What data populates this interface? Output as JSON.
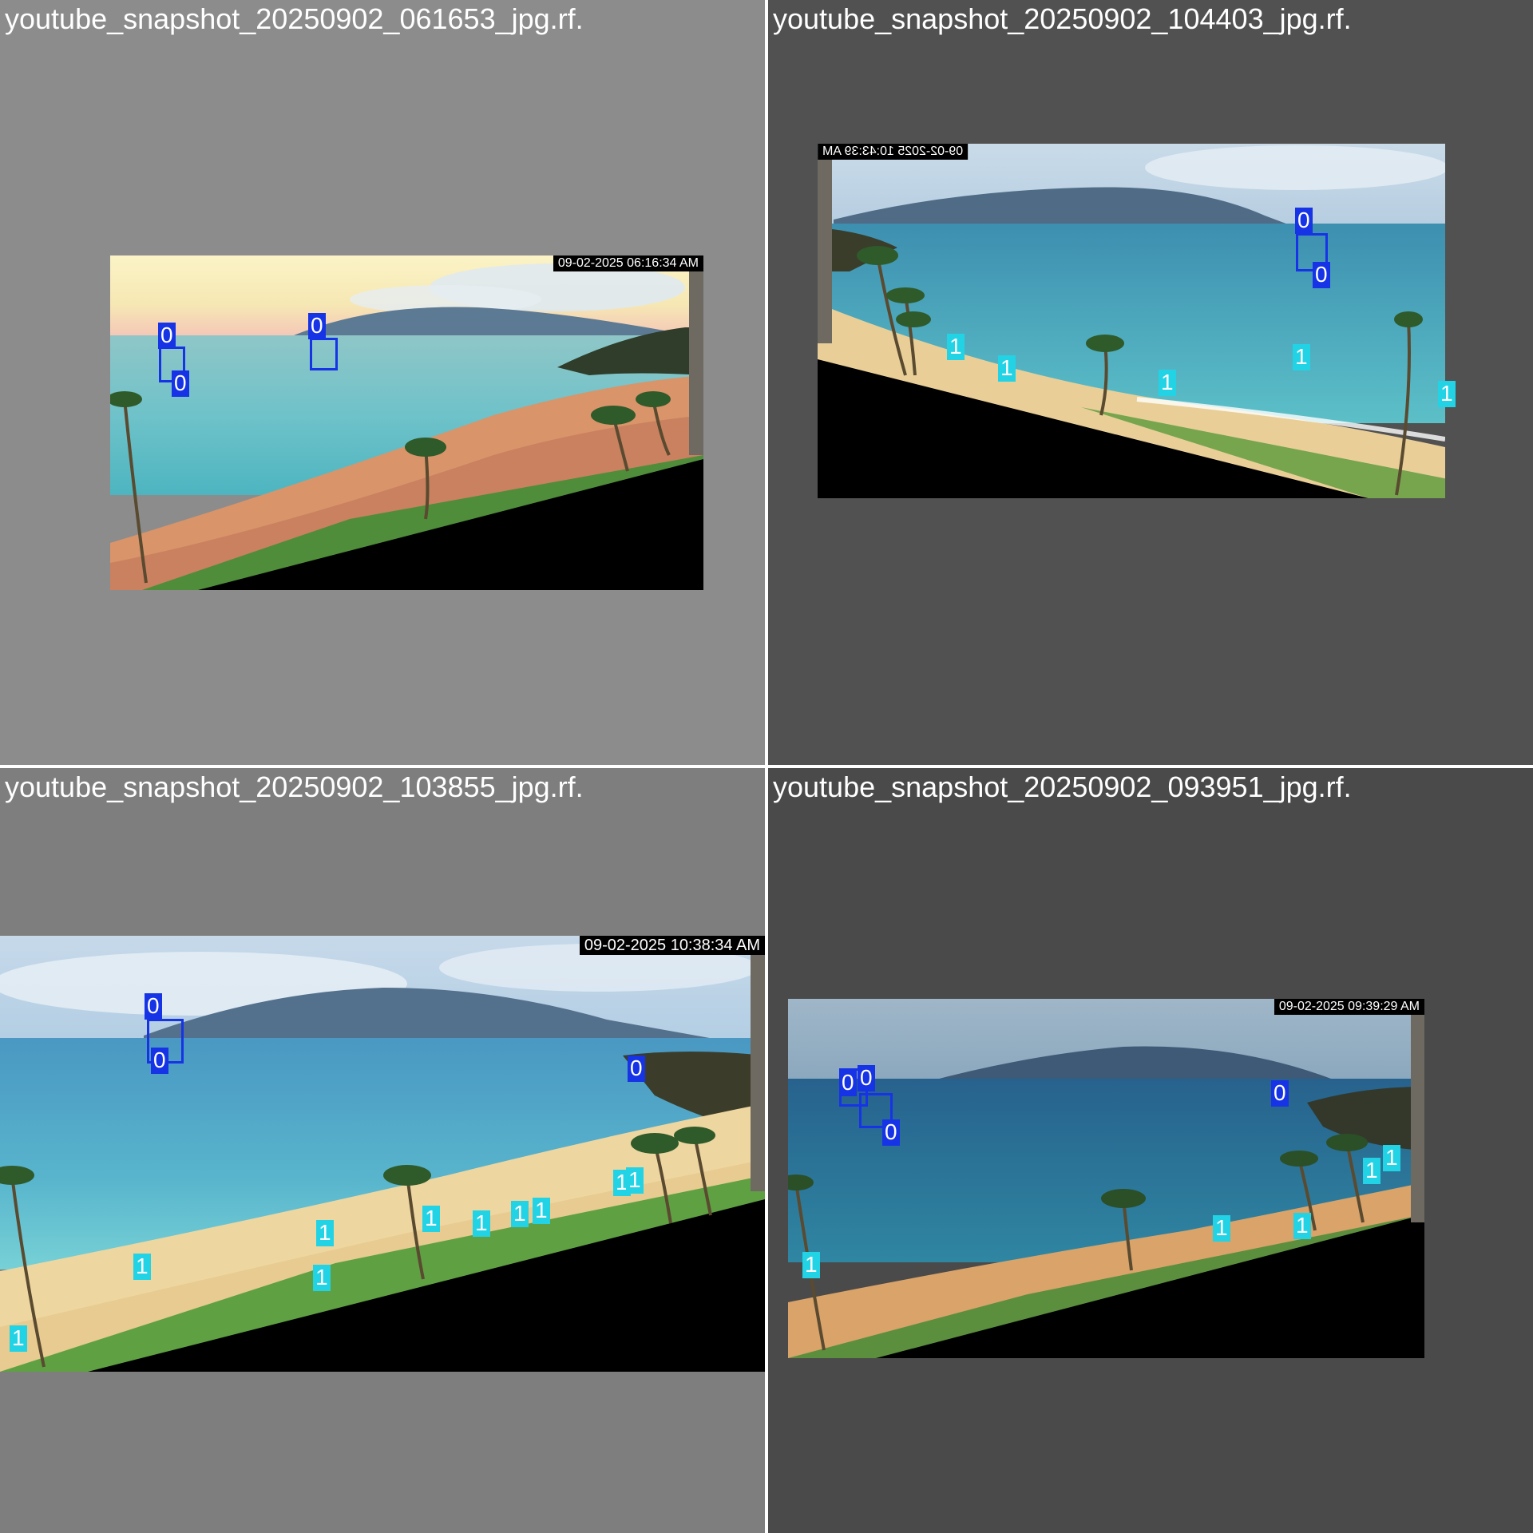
{
  "colors": {
    "class_0": "#1633e6",
    "class_1": "#22d3e6",
    "panel_light": "#8c8c8c",
    "panel_dark": "#515151",
    "panel_mid": "#7e7e7e",
    "panel_darker": "#4a4a4a"
  },
  "tiles": [
    {
      "title": "youtube_snapshot_20250902_061653_jpg.rf.",
      "timestamp": "09-02-2025 06:16:34 AM",
      "labels": [
        "0",
        "0",
        "0"
      ]
    },
    {
      "title": "youtube_snapshot_20250902_104403_jpg.rf.",
      "timestamp": "09-02-2025 10:43:39 AM",
      "labels": [
        "0",
        "0",
        "1",
        "1",
        "1",
        "1",
        "1"
      ]
    },
    {
      "title": "youtube_snapshot_20250902_103855_jpg.rf.",
      "timestamp": "09-02-2025 10:38:34 AM",
      "labels": [
        "0",
        "0",
        "0",
        "1",
        "1",
        "1",
        "1",
        "1",
        "1",
        "1",
        "1",
        "1",
        "1"
      ]
    },
    {
      "title": "youtube_snapshot_20250902_093951_jpg.rf.",
      "timestamp": "09-02-2025 09:39:29 AM",
      "labels": [
        "0",
        "0",
        "0",
        "0",
        "1",
        "1",
        "1",
        "1",
        "1"
      ]
    }
  ]
}
